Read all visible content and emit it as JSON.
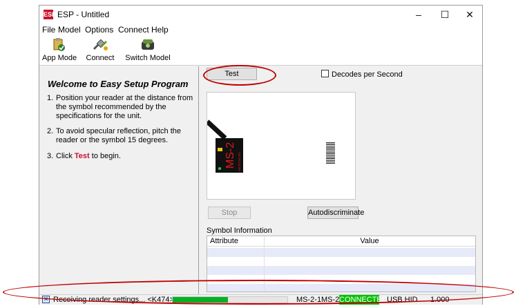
{
  "window": {
    "title": "ESP - Untitled",
    "app_icon_text": "ESP"
  },
  "controls": {
    "minimize": "–",
    "maximize": "☐",
    "close": "✕"
  },
  "menu": [
    "File",
    "Model",
    "Options",
    "Connect",
    "Help"
  ],
  "toolbar": {
    "buttons": [
      {
        "label": "App Mode",
        "icon": "app-mode-icon"
      },
      {
        "label": "Connect",
        "icon": "connect-icon"
      },
      {
        "label": "Switch Model",
        "icon": "switch-model-icon"
      }
    ]
  },
  "welcome": {
    "title": "Welcome to Easy Setup Program",
    "steps": [
      {
        "num": "1.",
        "text": "Position your reader at the distance from the symbol recommended by the specifications for the unit."
      },
      {
        "num": "2.",
        "text": "To avoid specular reflection, pitch the reader or the symbol 15 degrees."
      },
      {
        "num": "3.",
        "pre": "Click ",
        "bold": "Test",
        "post": " to begin."
      }
    ]
  },
  "right": {
    "test_button": "Test",
    "decodes_per_second": "Decodes per Second",
    "decodes_checked": false,
    "stop_button": "Stop",
    "autodiscriminate_button": "Autodiscriminate",
    "reader_label": "MS-2",
    "reader_brand": "MICROSCAN",
    "symbol_info_label": "Symbol Information",
    "table": {
      "headers": [
        "Attribute",
        "Value"
      ],
      "rows": []
    }
  },
  "status": {
    "message": "Receiving reader settings... <K474>",
    "progress": 0.48,
    "model_full": "MS-2-1",
    "model": "MS-2",
    "connection": "CONNECTED",
    "interface": "USB HID",
    "version": "1.000"
  },
  "colors": {
    "accent_red": "#c8102e",
    "connected_green": "#00c000",
    "progress_green": "#06b025",
    "row_alt": "#e6e9f8"
  }
}
